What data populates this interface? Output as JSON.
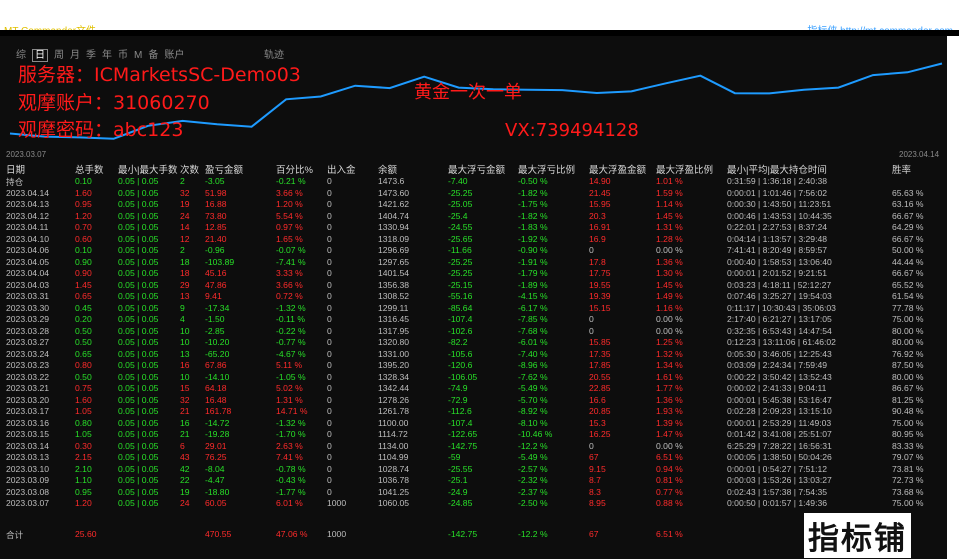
{
  "window": {
    "title": "MT Commander文件",
    "right_title": "指标侠 http://mt.commander.com"
  },
  "tabs": [
    "综",
    "日",
    "周",
    "月",
    "季",
    "年",
    "币",
    "M",
    "备",
    "账户"
  ],
  "active_tab": "日",
  "track_label": "轨迹",
  "overlay": {
    "server": "服务器：ICMarketsSC-Demo03",
    "account": "观摩账户：31060270",
    "password": "观摩密码：abc123",
    "gold": "黄金一次一单",
    "vx": "VX:739494128"
  },
  "chart_data": {
    "type": "line",
    "x": [
      "2023.03.07",
      "2023.03.08",
      "2023.03.09",
      "2023.03.10",
      "2023.03.13",
      "2023.03.14",
      "2023.03.15",
      "2023.03.16",
      "2023.03.17",
      "2023.03.20",
      "2023.03.21",
      "2023.03.22",
      "2023.03.23",
      "2023.03.24",
      "2023.03.27",
      "2023.03.28",
      "2023.03.29",
      "2023.03.30",
      "2023.03.31",
      "2023.04.03",
      "2023.04.04",
      "2023.04.05",
      "2023.04.06",
      "2023.04.10",
      "2023.04.11",
      "2023.04.12",
      "2023.04.13",
      "2023.04.14"
    ],
    "series": [
      {
        "values": [
          1060.05,
          1041.25,
          1036.78,
          1028.74,
          1104.99,
          1134.0,
          1114.72,
          1100.0,
          1261.78,
          1278.26,
          1342.44,
          1328.34,
          1395.2,
          1331.0,
          1320.8,
          1317.95,
          1316.45,
          1299.11,
          1308.52,
          1356.38,
          1401.54,
          1297.65,
          1296.69,
          1318.09,
          1330.94,
          1404.74,
          1421.62,
          1473.6
        ]
      }
    ],
    "x_start_label": "2023.03.07",
    "x_end_label": "2023.04.14",
    "line_color": "#1e9bff"
  },
  "table": {
    "headers": [
      "日期",
      "总手数",
      "最小|最大手数",
      "次数",
      "盈亏金额",
      "百分比%",
      "出入金",
      "余额",
      "最大浮亏金额",
      "最大浮亏比例",
      "最大浮盈金额",
      "最大浮盈比例",
      "最小|平均|最大持仓时间",
      "胜率"
    ],
    "position_row": {
      "date": "持仓",
      "lots": "0.10",
      "minmax": "0.05 | 0.05",
      "count": "2",
      "pl": "-3.05",
      "pct": "-0.21 %",
      "io": "0",
      "bal": "1473.6",
      "maxfl": "-7.40",
      "maxflp": "-0.50 %",
      "maxfp": "14.90",
      "maxfpp": "1.01 %",
      "hold": "0:31:59 | 1:36:18 | 2:40:38",
      "win": ""
    },
    "rows": [
      {
        "date": "2023.04.14",
        "lots": "1.60",
        "minmax": "0.05 | 0.05",
        "count": "32",
        "pl": "51.98",
        "pct": "3.66 %",
        "io": "0",
        "bal": "1473.60",
        "maxfl": "-25.25",
        "maxflp": "-1.82 %",
        "maxfp": "21.45",
        "maxfpp": "1.59 %",
        "hold": "0:00:01 | 1:01:46 | 7:56:02",
        "win": "65.63 %"
      },
      {
        "date": "2023.04.13",
        "lots": "0.95",
        "minmax": "0.05 | 0.05",
        "count": "19",
        "pl": "16.88",
        "pct": "1.20 %",
        "io": "0",
        "bal": "1421.62",
        "maxfl": "-25.05",
        "maxflp": "-1.75 %",
        "maxfp": "15.95",
        "maxfpp": "1.14 %",
        "hold": "0:00:30 | 1:43:50 | 11:23:51",
        "win": "63.16 %"
      },
      {
        "date": "2023.04.12",
        "lots": "1.20",
        "minmax": "0.05 | 0.05",
        "count": "24",
        "pl": "73.80",
        "pct": "5.54 %",
        "io": "0",
        "bal": "1404.74",
        "maxfl": "-25.4",
        "maxflp": "-1.82 %",
        "maxfp": "20.3",
        "maxfpp": "1.45 %",
        "hold": "0:00:46 | 1:43:53 | 10:44:35",
        "win": "66.67 %"
      },
      {
        "date": "2023.04.11",
        "lots": "0.70",
        "minmax": "0.05 | 0.05",
        "count": "14",
        "pl": "12.85",
        "pct": "0.97 %",
        "io": "0",
        "bal": "1330.94",
        "maxfl": "-24.55",
        "maxflp": "-1.83 %",
        "maxfp": "16.91",
        "maxfpp": "1.31 %",
        "hold": "0:22:01 | 2:27:53 | 8:37:24",
        "win": "64.29 %"
      },
      {
        "date": "2023.04.10",
        "lots": "0.60",
        "minmax": "0.05 | 0.05",
        "count": "12",
        "pl": "21.40",
        "pct": "1.65 %",
        "io": "0",
        "bal": "1318.09",
        "maxfl": "-25.65",
        "maxflp": "-1.92 %",
        "maxfp": "16.9",
        "maxfpp": "1.28 %",
        "hold": "0:04:14 | 1:13:57 | 3:29:48",
        "win": "66.67 %"
      },
      {
        "date": "2023.04.06",
        "lots": "0.10",
        "minmax": "0.05 | 0.05",
        "count": "2",
        "pl": "-0.96",
        "pct": "-0.07 %",
        "io": "0",
        "bal": "1296.69",
        "maxfl": "-11.66",
        "maxflp": "-0.90 %",
        "maxfp": "0",
        "maxfpp": "0.00 %",
        "hold": "7:41:41 | 8:20:49 | 8:59:57",
        "win": "50.00 %"
      },
      {
        "date": "2023.04.05",
        "lots": "0.90",
        "minmax": "0.05 | 0.05",
        "count": "18",
        "pl": "-103.89",
        "pct": "-7.41 %",
        "io": "0",
        "bal": "1297.65",
        "maxfl": "-25.25",
        "maxflp": "-1.91 %",
        "maxfp": "17.8",
        "maxfpp": "1.36 %",
        "hold": "0:00:40 | 1:58:53 | 13:06:40",
        "win": "44.44 %"
      },
      {
        "date": "2023.04.04",
        "lots": "0.90",
        "minmax": "0.05 | 0.05",
        "count": "18",
        "pl": "45.16",
        "pct": "3.33 %",
        "io": "0",
        "bal": "1401.54",
        "maxfl": "-25.25",
        "maxflp": "-1.79 %",
        "maxfp": "17.75",
        "maxfpp": "1.30 %",
        "hold": "0:00:01 | 2:01:52 | 9:21:51",
        "win": "66.67 %"
      },
      {
        "date": "2023.04.03",
        "lots": "1.45",
        "minmax": "0.05 | 0.05",
        "count": "29",
        "pl": "47.86",
        "pct": "3.66 %",
        "io": "0",
        "bal": "1356.38",
        "maxfl": "-25.15",
        "maxflp": "-1.89 %",
        "maxfp": "19.55",
        "maxfpp": "1.45 %",
        "hold": "0:03:23 | 4:18:11 | 52:12:27",
        "win": "65.52 %"
      },
      {
        "date": "2023.03.31",
        "lots": "0.65",
        "minmax": "0.05 | 0.05",
        "count": "13",
        "pl": "9.41",
        "pct": "0.72 %",
        "io": "0",
        "bal": "1308.52",
        "maxfl": "-55.16",
        "maxflp": "-4.15 %",
        "maxfp": "19.39",
        "maxfpp": "1.49 %",
        "hold": "0:07:46 | 3:25:27 | 19:54:03",
        "win": "61.54 %"
      },
      {
        "date": "2023.03.30",
        "lots": "0.45",
        "minmax": "0.05 | 0.05",
        "count": "9",
        "pl": "-17.34",
        "pct": "-1.32 %",
        "io": "0",
        "bal": "1299.11",
        "maxfl": "-85.64",
        "maxflp": "-6.17 %",
        "maxfp": "15.15",
        "maxfpp": "1.16 %",
        "hold": "0:11:17 | 10:30:43 | 35:06:03",
        "win": "77.78 %"
      },
      {
        "date": "2023.03.29",
        "lots": "0.20",
        "minmax": "0.05 | 0.05",
        "count": "4",
        "pl": "-1.50",
        "pct": "-0.11 %",
        "io": "0",
        "bal": "1316.45",
        "maxfl": "-107.4",
        "maxflp": "-7.85 %",
        "maxfp": "0",
        "maxfpp": "0.00 %",
        "hold": "2:17:40 | 6:21:27 | 13:17:05",
        "win": "75.00 %"
      },
      {
        "date": "2023.03.28",
        "lots": "0.50",
        "minmax": "0.05 | 0.05",
        "count": "10",
        "pl": "-2.85",
        "pct": "-0.22 %",
        "io": "0",
        "bal": "1317.95",
        "maxfl": "-102.6",
        "maxflp": "-7.68 %",
        "maxfp": "0",
        "maxfpp": "0.00 %",
        "hold": "0:32:35 | 6:53:43 | 14:47:54",
        "win": "80.00 %"
      },
      {
        "date": "2023.03.27",
        "lots": "0.50",
        "minmax": "0.05 | 0.05",
        "count": "10",
        "pl": "-10.20",
        "pct": "-0.77 %",
        "io": "0",
        "bal": "1320.80",
        "maxfl": "-82.2",
        "maxflp": "-6.01 %",
        "maxfp": "15.85",
        "maxfpp": "1.25 %",
        "hold": "0:12:23 | 13:11:06 | 61:46:02",
        "win": "80.00 %"
      },
      {
        "date": "2023.03.24",
        "lots": "0.65",
        "minmax": "0.05 | 0.05",
        "count": "13",
        "pl": "-65.20",
        "pct": "-4.67 %",
        "io": "0",
        "bal": "1331.00",
        "maxfl": "-105.6",
        "maxflp": "-7.40 %",
        "maxfp": "17.35",
        "maxfpp": "1.32 %",
        "hold": "0:05:30 | 3:46:05 | 12:25:43",
        "win": "76.92 %"
      },
      {
        "date": "2023.03.23",
        "lots": "0.80",
        "minmax": "0.05 | 0.05",
        "count": "16",
        "pl": "67.86",
        "pct": "5.11 %",
        "io": "0",
        "bal": "1395.20",
        "maxfl": "-120.6",
        "maxflp": "-8.96 %",
        "maxfp": "17.85",
        "maxfpp": "1.34 %",
        "hold": "0:03:09 | 2:24:34 | 7:59:49",
        "win": "87.50 %"
      },
      {
        "date": "2023.03.22",
        "lots": "0.50",
        "minmax": "0.05 | 0.05",
        "count": "10",
        "pl": "-14.10",
        "pct": "-1.05 %",
        "io": "0",
        "bal": "1328.34",
        "maxfl": "-106.05",
        "maxflp": "-7.62 %",
        "maxfp": "20.55",
        "maxfpp": "1.61 %",
        "hold": "0:00:22 | 3:50:42 | 13:52:43",
        "win": "80.00 %"
      },
      {
        "date": "2023.03.21",
        "lots": "0.75",
        "minmax": "0.05 | 0.05",
        "count": "15",
        "pl": "64.18",
        "pct": "5.02 %",
        "io": "0",
        "bal": "1342.44",
        "maxfl": "-74.9",
        "maxflp": "-5.49 %",
        "maxfp": "22.85",
        "maxfpp": "1.77 %",
        "hold": "0:00:02 | 2:41:33 | 9:04:11",
        "win": "86.67 %"
      },
      {
        "date": "2023.03.20",
        "lots": "1.60",
        "minmax": "0.05 | 0.05",
        "count": "32",
        "pl": "16.48",
        "pct": "1.31 %",
        "io": "0",
        "bal": "1278.26",
        "maxfl": "-72.9",
        "maxflp": "-5.70 %",
        "maxfp": "16.6",
        "maxfpp": "1.36 %",
        "hold": "0:00:01 | 5:45:38 | 53:16:47",
        "win": "81.25 %"
      },
      {
        "date": "2023.03.17",
        "lots": "1.05",
        "minmax": "0.05 | 0.05",
        "count": "21",
        "pl": "161.78",
        "pct": "14.71 %",
        "io": "0",
        "bal": "1261.78",
        "maxfl": "-112.6",
        "maxflp": "-8.92 %",
        "maxfp": "20.85",
        "maxfpp": "1.93 %",
        "hold": "0:02:28 | 2:09:23 | 13:15:10",
        "win": "90.48 %"
      },
      {
        "date": "2023.03.16",
        "lots": "0.80",
        "minmax": "0.05 | 0.05",
        "count": "16",
        "pl": "-14.72",
        "pct": "-1.32 %",
        "io": "0",
        "bal": "1100.00",
        "maxfl": "-107.4",
        "maxflp": "-8.10 %",
        "maxfp": "15.3",
        "maxfpp": "1.39 %",
        "hold": "0:00:01 | 2:53:29 | 11:49:03",
        "win": "75.00 %"
      },
      {
        "date": "2023.03.15",
        "lots": "1.05",
        "minmax": "0.05 | 0.05",
        "count": "21",
        "pl": "-19.28",
        "pct": "-1.70 %",
        "io": "0",
        "bal": "1114.72",
        "maxfl": "-122.65",
        "maxflp": "-10.46 %",
        "maxfp": "16.25",
        "maxfpp": "1.47 %",
        "hold": "0:01:42 | 3:41:08 | 25:51:07",
        "win": "80.95 %"
      },
      {
        "date": "2023.03.14",
        "lots": "0.30",
        "minmax": "0.05 | 0.05",
        "count": "6",
        "pl": "29.01",
        "pct": "2.63 %",
        "io": "0",
        "bal": "1134.00",
        "maxfl": "-142.75",
        "maxflp": "-12.2 %",
        "maxfp": "0",
        "maxfpp": "0.00 %",
        "hold": "6:25:29 | 7:28:22 | 16:56:31",
        "win": "83.33 %"
      },
      {
        "date": "2023.03.13",
        "lots": "2.15",
        "minmax": "0.05 | 0.05",
        "count": "43",
        "pl": "76.25",
        "pct": "7.41 %",
        "io": "0",
        "bal": "1104.99",
        "maxfl": "-59",
        "maxflp": "-5.49 %",
        "maxfp": "67",
        "maxfpp": "6.51 %",
        "hold": "0:00:05 | 1:38:50 | 50:04:26",
        "win": "79.07 %"
      },
      {
        "date": "2023.03.10",
        "lots": "2.10",
        "minmax": "0.05 | 0.05",
        "count": "42",
        "pl": "-8.04",
        "pct": "-0.78 %",
        "io": "0",
        "bal": "1028.74",
        "maxfl": "-25.55",
        "maxflp": "-2.57 %",
        "maxfp": "9.15",
        "maxfpp": "0.94 %",
        "hold": "0:00:01 | 0:54:27 | 7:51:12",
        "win": "73.81 %"
      },
      {
        "date": "2023.03.09",
        "lots": "1.10",
        "minmax": "0.05 | 0.05",
        "count": "22",
        "pl": "-4.47",
        "pct": "-0.43 %",
        "io": "0",
        "bal": "1036.78",
        "maxfl": "-25.1",
        "maxflp": "-2.32 %",
        "maxfp": "8.7",
        "maxfpp": "0.81 %",
        "hold": "0:00:03 | 1:53:26 | 13:03:27",
        "win": "72.73 %"
      },
      {
        "date": "2023.03.08",
        "lots": "0.95",
        "minmax": "0.05 | 0.05",
        "count": "19",
        "pl": "-18.80",
        "pct": "-1.77 %",
        "io": "0",
        "bal": "1041.25",
        "maxfl": "-24.9",
        "maxflp": "-2.37 %",
        "maxfp": "8.3",
        "maxfpp": "0.77 %",
        "hold": "0:02:43 | 1:57:38 | 7:54:35",
        "win": "73.68 %"
      },
      {
        "date": "2023.03.07",
        "lots": "1.20",
        "minmax": "0.05 | 0.05",
        "count": "24",
        "pl": "60.05",
        "pct": "6.01 %",
        "io": "1000",
        "bal": "1060.05",
        "maxfl": "-24.85",
        "maxflp": "-2.50 %",
        "maxfp": "8.95",
        "maxfpp": "0.88 %",
        "hold": "0:00:50 | 0:01:57 | 1:49:36",
        "win": "75.00 %"
      }
    ],
    "total_row": {
      "date": "合计",
      "lots": "25.60",
      "minmax": "",
      "count": "",
      "pl": "470.55",
      "pct": "47.06 %",
      "io": "1000",
      "bal": "",
      "maxfl": "-142.75",
      "maxflp": "-12.2 %",
      "maxfp": "67",
      "maxfpp": "6.51 %",
      "hold": "",
      "win": ""
    }
  },
  "watermark": "指标铺",
  "colors": {
    "positive": "#ff2b2b",
    "negative": "#28e028",
    "line": "#1e9bff",
    "background": "#0d0d0d"
  }
}
